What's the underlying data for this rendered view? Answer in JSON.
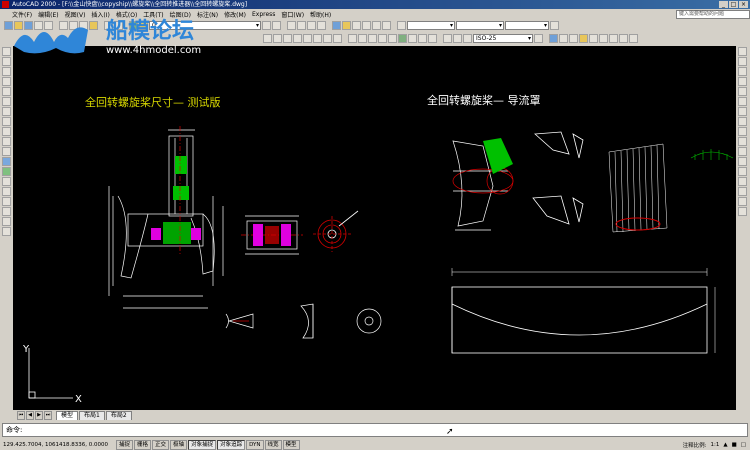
{
  "window": {
    "title": "AutoCAD 2000 - [F:\\\\金山快盘\\\\copyship\\\\螺旋桨\\\\全回转推进器\\\\全回转螺旋桨.dwg]",
    "min": "_",
    "max": "□",
    "close": "×"
  },
  "menu": {
    "items": [
      "文件(F)",
      "编辑(E)",
      "视图(V)",
      "插入(I)",
      "格式(O)",
      "工具(T)",
      "绘图(D)",
      "标注(N)",
      "修改(M)",
      "Express",
      "窗口(W)",
      "帮助(H)"
    ],
    "help_placeholder": "键入需要帮助的问题"
  },
  "toolbar": {
    "layer_value": "0",
    "dimstyle_value": "ISO-25"
  },
  "watermark": {
    "text": "船模论坛",
    "url": "www.4hmodel.com"
  },
  "drawing": {
    "title_left": "全回转螺旋桨尺寸— 测试版",
    "title_right": "全回转螺旋桨— 导流罩"
  },
  "ucs": {
    "x": "X",
    "y": "Y"
  },
  "tabs": [
    "模型",
    "布局1",
    "布局2"
  ],
  "command": {
    "prompt": "命令:"
  },
  "status": {
    "coords": "129.425.7004, 1061418.8336, 0.0000",
    "buttons": [
      "捕捉",
      "栅格",
      "正交",
      "极轴",
      "对象捕捉",
      "对象追踪",
      "DYN",
      "线宽",
      "模型"
    ],
    "scale_label": "注释比例:",
    "scale_value": "1:1"
  },
  "colors": {
    "canvas": "#000000",
    "title_text": "#d8d800",
    "geometry": "#ffffff",
    "accent_green": "#00c000",
    "accent_red": "#d80000",
    "accent_magenta": "#e000e0"
  }
}
